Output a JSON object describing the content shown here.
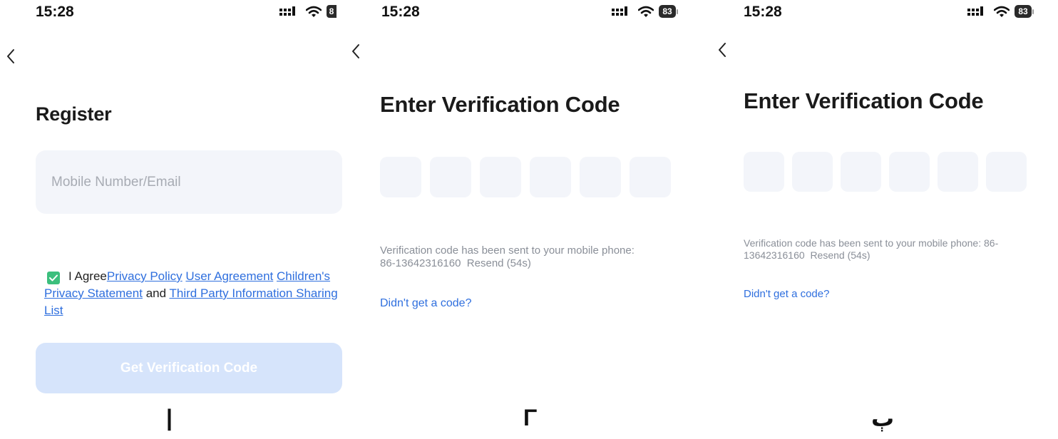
{
  "screens": [
    {
      "status": {
        "time": "15:28",
        "battery": "8"
      },
      "title": "Register",
      "input": {
        "placeholder": "Mobile Number/Email",
        "value": ""
      },
      "agreement": {
        "checked": true,
        "prefix": "I Agree",
        "privacy_policy": "Privacy Policy",
        "user_agreement": "User Agreement",
        "childrens_privacy": "Children's Privacy Statement",
        "and": "and",
        "third_party": "Third Party Information Sharing List"
      },
      "button": "Get Verification Code",
      "caption": "|"
    },
    {
      "status": {
        "time": "15:28",
        "battery": "83"
      },
      "title": "Enter Verification Code",
      "code_digits": [
        "",
        "",
        "",
        "",
        "",
        ""
      ],
      "sent_message": "Verification code has been sent to your mobile phone: 86-13642316160",
      "resend": "Resend (54s)",
      "help_link": "Didn't get a code?",
      "caption": "Γ"
    },
    {
      "status": {
        "time": "15:28",
        "battery": "83"
      },
      "title": "Enter Verification Code",
      "code_digits": [
        "",
        "",
        "",
        "",
        "",
        ""
      ],
      "sent_message": "Verification code has been sent to your mobile phone: 86-13642316160",
      "resend": "Resend (54s)",
      "help_link": "Didn't get a code?",
      "caption": "ٻ"
    }
  ],
  "colors": {
    "accent_link": "#2f6fde",
    "checkbox": "#3cbf7d",
    "input_bg": "#f3f5fa",
    "button_disabled": "#d6e4fb",
    "muted_text": "#8a8f98"
  }
}
